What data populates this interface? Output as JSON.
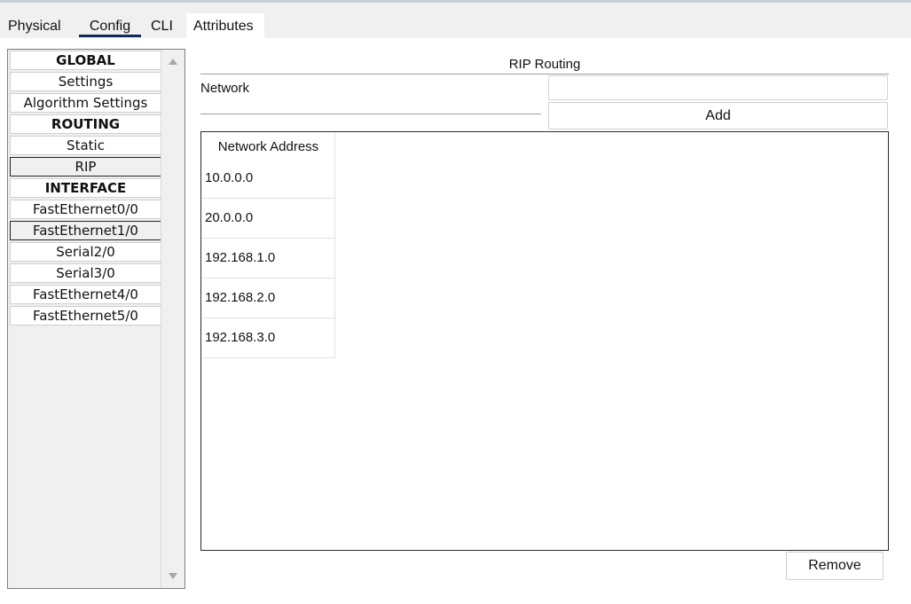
{
  "tabs": [
    "Physical",
    "Config",
    "CLI",
    "Attributes"
  ],
  "active_tab": "Config",
  "sidebar": {
    "items": [
      {
        "label": "GLOBAL",
        "type": "header"
      },
      {
        "label": "Settings",
        "type": "item"
      },
      {
        "label": "Algorithm Settings",
        "type": "item"
      },
      {
        "label": "ROUTING",
        "type": "header"
      },
      {
        "label": "Static",
        "type": "item"
      },
      {
        "label": "RIP",
        "type": "item",
        "selected": true
      },
      {
        "label": "INTERFACE",
        "type": "header"
      },
      {
        "label": "FastEthernet0/0",
        "type": "item"
      },
      {
        "label": "FastEthernet1/0",
        "type": "item",
        "selected": true
      },
      {
        "label": "Serial2/0",
        "type": "item"
      },
      {
        "label": "Serial3/0",
        "type": "item"
      },
      {
        "label": "FastEthernet4/0",
        "type": "item"
      },
      {
        "label": "FastEthernet5/0",
        "type": "item"
      }
    ]
  },
  "main": {
    "title": "RIP Routing",
    "network_label": "Network",
    "network_value": "",
    "add_label": "Add",
    "table_header": "Network Address",
    "networks": [
      "10.0.0.0",
      "20.0.0.0",
      "192.168.1.0",
      "192.168.2.0",
      "192.168.3.0"
    ],
    "remove_label": "Remove"
  },
  "colors": {
    "tab_underline": "#0f2a57",
    "panel_bg": "#ffffff",
    "window_bg": "#f0f0f0"
  }
}
